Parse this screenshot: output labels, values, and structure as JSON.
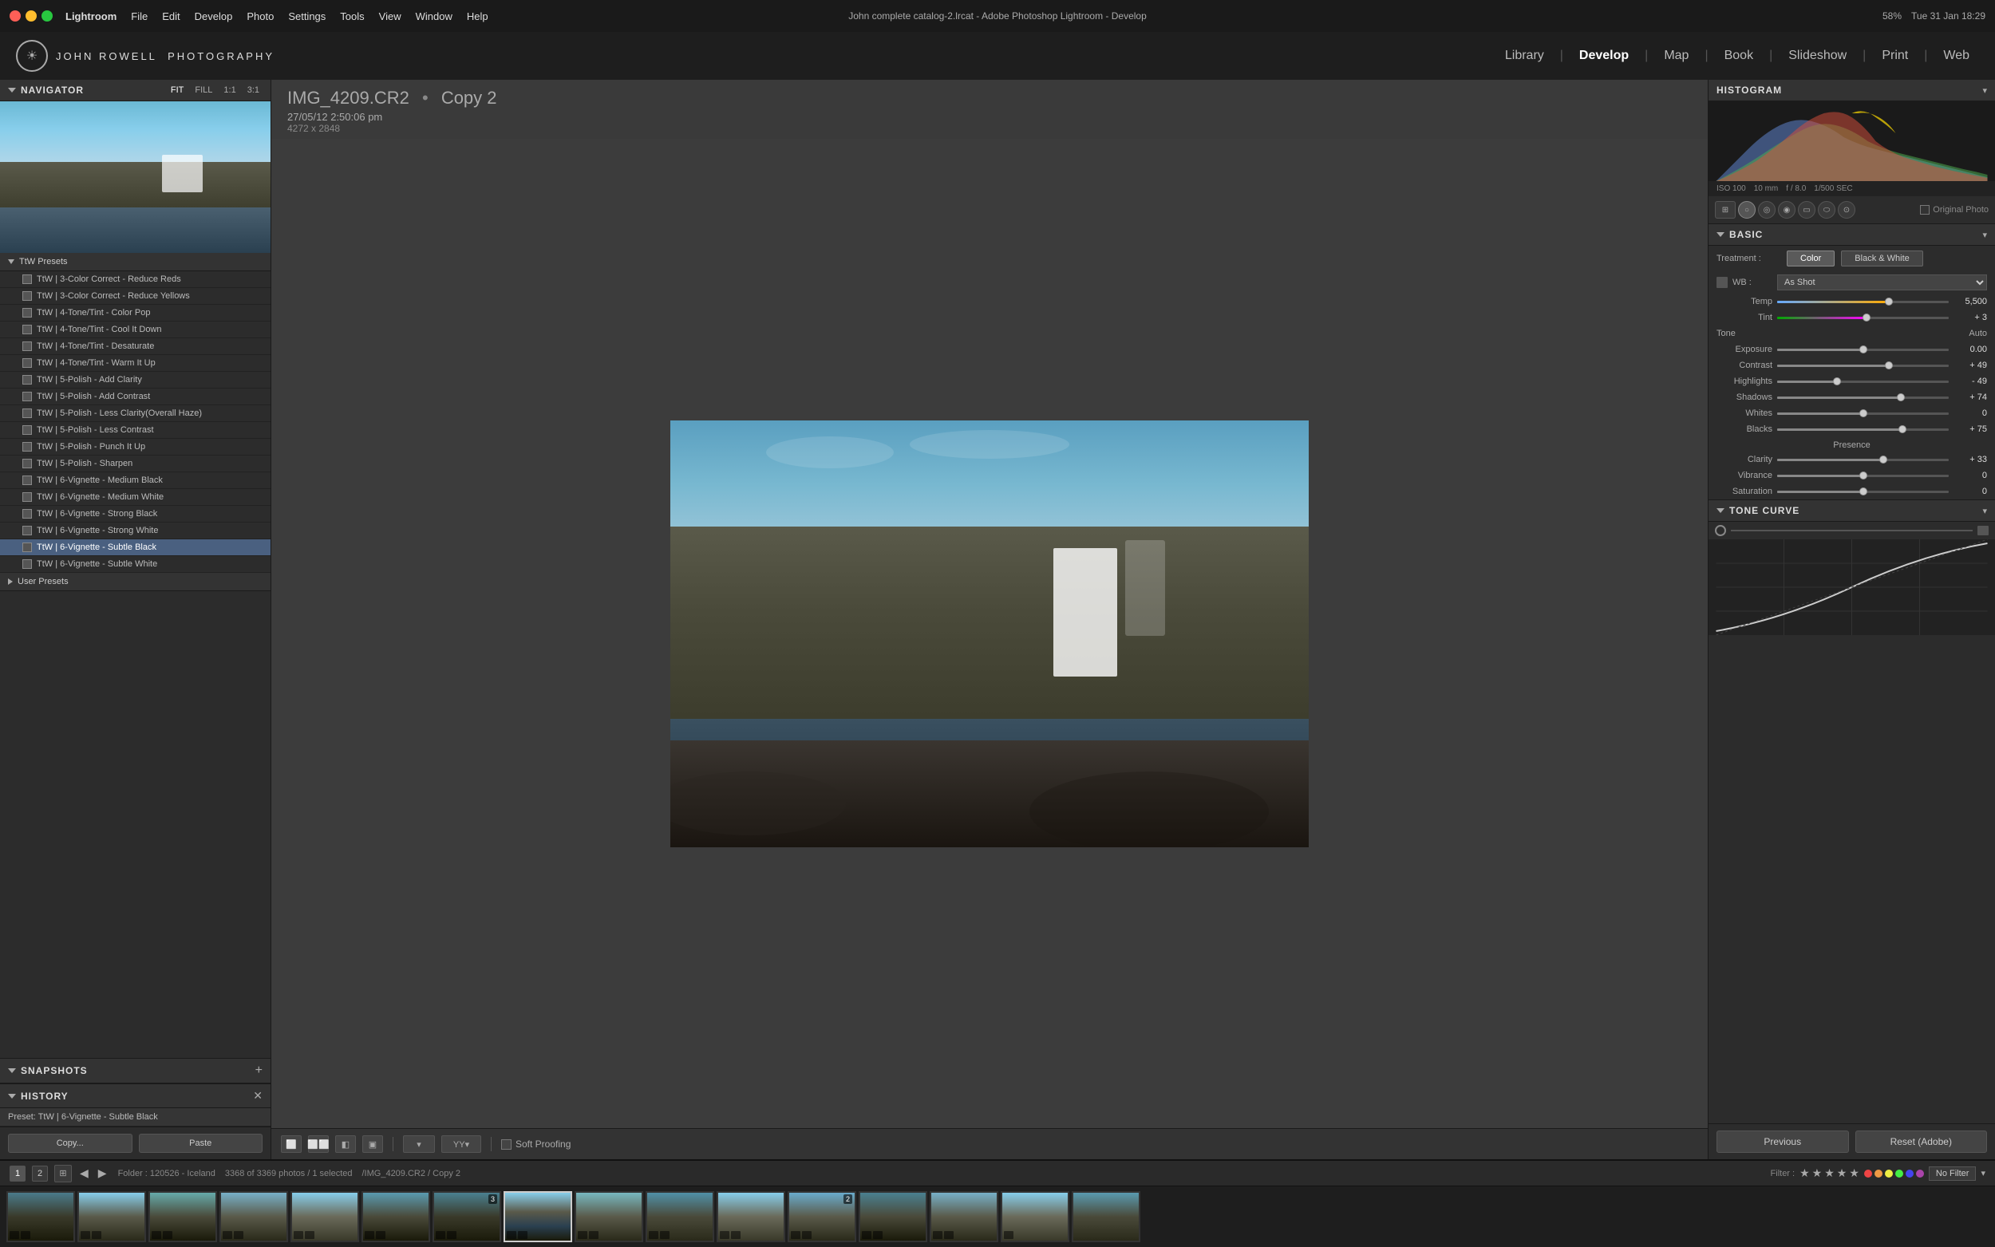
{
  "app": {
    "title": "John complete catalog-2.lrcat - Adobe Photoshop Lightroom - Develop",
    "app_name": "Lightroom"
  },
  "menubar": {
    "menus": [
      "Lightroom",
      "File",
      "Edit",
      "Develop",
      "Photo",
      "Settings",
      "Tools",
      "View",
      "Window",
      "Help"
    ],
    "time": "Tue 31 Jan  18:29",
    "battery": "58%"
  },
  "navbar": {
    "logo_text": "JOHN ROWELL\nPHOTOGRAPHY",
    "links": [
      "Library",
      "Develop",
      "Map",
      "Book",
      "Slideshow",
      "Print",
      "Web"
    ],
    "active": "Develop"
  },
  "navigator": {
    "title": "Navigator",
    "zoom_options": [
      "FIT",
      "FILL",
      "1:1",
      "3:1"
    ]
  },
  "presets": {
    "user_presets_label": "User Presets",
    "items": [
      "TtW | 3-Color Correct - Reduce Reds",
      "TtW | 3-Color Correct - Reduce Yellows",
      "TtW | 4-Tone/Tint - Color Pop",
      "TtW | 4-Tone/Tint - Cool It Down",
      "TtW | 4-Tone/Tint - Desaturate",
      "TtW | 4-Tone/Tint - Warm It Up",
      "TtW | 5-Polish - Add Clarity",
      "TtW | 5-Polish - Add Contrast",
      "TtW | 5-Polish - Less Clarity(Overall Haze)",
      "TtW | 5-Polish - Less Contrast",
      "TtW | 5-Polish - Punch It Up",
      "TtW | 5-Polish - Sharpen",
      "TtW | 6-Vignette - Medium Black",
      "TtW | 6-Vignette - Medium White",
      "TtW | 6-Vignette - Strong Black",
      "TtW | 6-Vignette - Strong White",
      "TtW | 6-Vignette - Subtle Black",
      "TtW | 6-Vignette - Subtle White"
    ],
    "selected": "TtW | 6-Vignette - Subtle Black"
  },
  "snapshots": {
    "title": "Snapshots",
    "add_btn": "+"
  },
  "history": {
    "title": "History",
    "close_btn": "✕",
    "item": "Preset: TtW | 6-Vignette - Subtle Black"
  },
  "left_toolbar": {
    "copy_btn": "Copy...",
    "paste_btn": "Paste"
  },
  "photo": {
    "filename": "IMG_4209.CR2",
    "separator": "•",
    "copy": "Copy 2",
    "datetime": "27/05/12  2:50:06 pm",
    "dimensions": "4272 x 2848"
  },
  "center_toolbar": {
    "soft_proof_label": "Soft Proofing"
  },
  "histogram": {
    "title": "Histogram",
    "iso": "ISO 100",
    "focal": "10 mm",
    "aperture": "f / 8.0",
    "shutter": "1/500 SEC",
    "original_photo_label": "Original Photo"
  },
  "basic": {
    "title": "Basic",
    "treatment_label": "Treatment :",
    "color_btn": "Color",
    "bw_btn": "Black & White",
    "wb_label": "WB :",
    "wb_value": "As Shot",
    "tone_label": "Tone",
    "tone_auto": "Auto",
    "sliders": {
      "temp": {
        "label": "Temp",
        "value": "5,500",
        "pct": 65
      },
      "tint": {
        "label": "Tint",
        "value": "+ 3",
        "pct": 52
      },
      "exposure": {
        "label": "Exposure",
        "value": "0.00",
        "pct": 50
      },
      "contrast": {
        "label": "Contrast",
        "value": "+ 49",
        "pct": 65
      },
      "highlights": {
        "label": "Highlights",
        "value": "- 49",
        "pct": 35
      },
      "shadows": {
        "label": "Shadows",
        "value": "+ 74",
        "pct": 72
      },
      "whites": {
        "label": "Whites",
        "value": "0",
        "pct": 50
      },
      "blacks": {
        "label": "Blacks",
        "value": "+ 75",
        "pct": 73
      },
      "clarity": {
        "label": "Clarity",
        "value": "+ 33",
        "pct": 62
      },
      "vibrance": {
        "label": "Vibrance",
        "value": "0",
        "pct": 50
      },
      "saturation": {
        "label": "Saturation",
        "value": "0",
        "pct": 50
      }
    },
    "presence_label": "Presence"
  },
  "tone_curve": {
    "title": "Tone Curve"
  },
  "right_btns": {
    "previous": "Previous",
    "reset": "Reset (Adobe)"
  },
  "filmstrip": {
    "folder": "Folder : 120526 - Iceland",
    "count": "3368 of 3369 photos / 1 selected",
    "path": "/IMG_4209.CR2 / Copy 2",
    "filter_label": "Filter :",
    "no_filter": "No Filter",
    "selected_index": 7
  },
  "colors": {
    "accent_blue": "#4a6080",
    "selected_white": "#ffffff",
    "bg_dark": "#1a1a1a",
    "panel_bg": "#2c2c2c",
    "header_bg": "#333333"
  }
}
